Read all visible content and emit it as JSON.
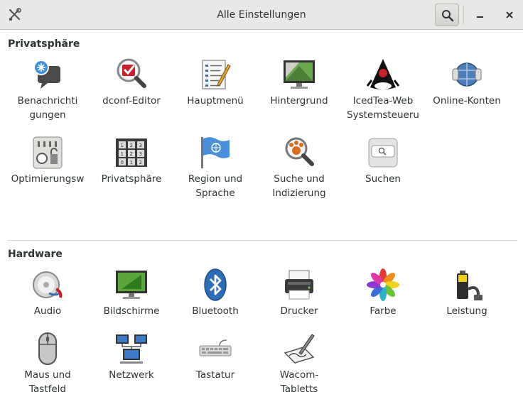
{
  "window": {
    "title": "Alle Einstellungen"
  },
  "sections": {
    "personal": {
      "title": "Privatsphäre",
      "items": [
        {
          "label": "Benachrichti\ngungen",
          "icon": "notification-icon"
        },
        {
          "label": "dconf-Editor",
          "icon": "dconf-editor-icon"
        },
        {
          "label": "Hauptmenü",
          "icon": "main-menu-icon"
        },
        {
          "label": "Hintergrund",
          "icon": "background-icon"
        },
        {
          "label": "IcedTea-Web\nSystemsteueru",
          "icon": "icedtea-icon"
        },
        {
          "label": "Online-Konten",
          "icon": "online-accounts-icon"
        },
        {
          "label": "Optimierungsw",
          "icon": "tweaks-icon"
        },
        {
          "label": "Privatsphäre",
          "icon": "privacy-icon"
        },
        {
          "label": "Region und\nSprache",
          "icon": "region-flag-icon"
        },
        {
          "label": "Suche und\nIndizierung",
          "icon": "indexing-search-icon"
        },
        {
          "label": "Suchen",
          "icon": "search-settings-icon"
        }
      ]
    },
    "hardware": {
      "title": "Hardware",
      "items": [
        {
          "label": "Audio",
          "icon": "audio-icon"
        },
        {
          "label": "Bildschirme",
          "icon": "displays-icon"
        },
        {
          "label": "Bluetooth",
          "icon": "bluetooth-icon"
        },
        {
          "label": "Drucker",
          "icon": "printer-icon"
        },
        {
          "label": "Farbe",
          "icon": "color-icon"
        },
        {
          "label": "Leistung",
          "icon": "power-icon"
        },
        {
          "label": "Maus und\nTastfeld",
          "icon": "mouse-icon"
        },
        {
          "label": "Netzwerk",
          "icon": "network-icon"
        },
        {
          "label": "Tastatur",
          "icon": "keyboard-icon"
        },
        {
          "label": "Wacom-\nTabletts",
          "icon": "wacom-tablet-icon"
        }
      ]
    }
  }
}
